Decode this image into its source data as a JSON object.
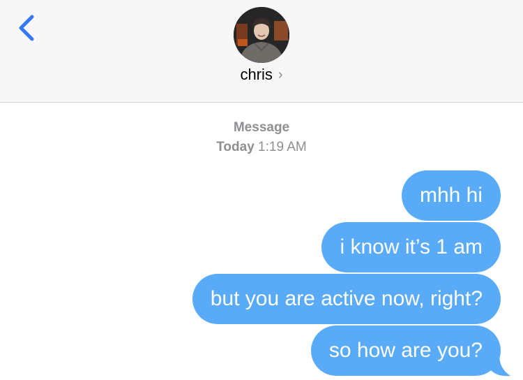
{
  "header": {
    "back_icon": "chevron-left-icon",
    "contact_name": "chris",
    "contact_chevron": "›"
  },
  "thread": {
    "service_label": "Message",
    "date_label": "Today",
    "time_label": "1:19 AM"
  },
  "messages": [
    {
      "text": "mhh hi",
      "direction": "outgoing"
    },
    {
      "text": "i know it’s 1 am",
      "direction": "outgoing"
    },
    {
      "text": "but you are active now, right?",
      "direction": "outgoing"
    },
    {
      "text": "so how are you?",
      "direction": "outgoing"
    }
  ],
  "colors": {
    "outgoing_bubble": "#5aabf7",
    "accent_blue": "#3478f6",
    "header_bg": "#f7f7f7",
    "meta_gray": "#8e8e93"
  }
}
